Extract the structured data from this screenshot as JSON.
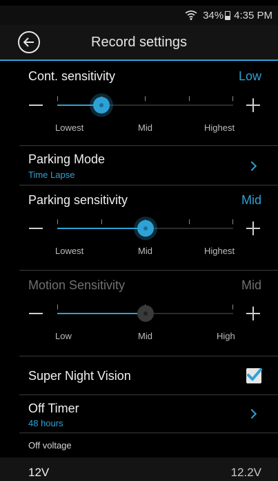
{
  "status": {
    "battery": "34%",
    "time": "4:35 PM"
  },
  "header": {
    "title": "Record settings"
  },
  "cont_sensitivity": {
    "label": "Cont. sensitivity",
    "value": "Low",
    "level": 0.25,
    "scale": [
      "Lowest",
      "Mid",
      "Highest"
    ]
  },
  "parking_mode": {
    "label": "Parking Mode",
    "sub": "Time Lapse"
  },
  "parking_sensitivity": {
    "label": "Parking sensitivity",
    "value": "Mid",
    "level": 0.5,
    "scale": [
      "Lowest",
      "Mid",
      "Highest"
    ]
  },
  "motion_sensitivity": {
    "label": "Motion Sensitivity",
    "value": "Mid",
    "level": 0.5,
    "scale": [
      "Low",
      "Mid",
      "High"
    ],
    "enabled": false
  },
  "super_night_vision": {
    "label": "Super Night Vision",
    "checked": true
  },
  "off_timer": {
    "label": "Off Timer",
    "sub": "48 hours"
  },
  "off_voltage": {
    "label": "Off voltage"
  },
  "voltage_row": {
    "left": "12V",
    "right": "12.2V"
  },
  "colors": {
    "accent": "#2ea2d6",
    "background": "#000000"
  }
}
